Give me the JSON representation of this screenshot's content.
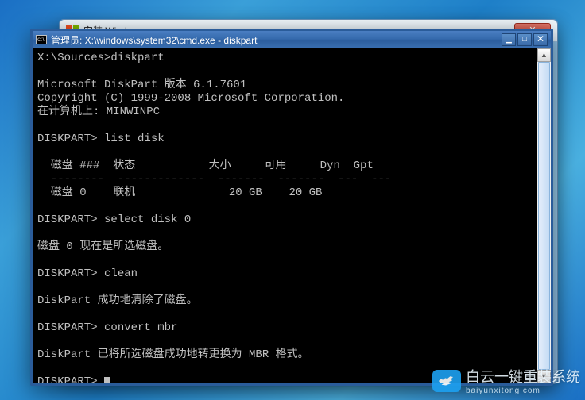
{
  "bg_window": {
    "title_fragment": "安装 Windows"
  },
  "cmd": {
    "icon_glyph": "c:\\",
    "title": "管理员: X:\\windows\\system32\\cmd.exe - diskpart",
    "minimize_glyph": "▁",
    "maximize_glyph": "□",
    "close_glyph": "✕"
  },
  "bg_close_glyph": "✕",
  "scrollbar": {
    "up_glyph": "▲",
    "down_glyph": "▼"
  },
  "term": {
    "l01": "X:\\Sources>diskpart",
    "l02": "",
    "l03": "Microsoft DiskPart 版本 6.1.7601",
    "l04": "Copyright (C) 1999-2008 Microsoft Corporation.",
    "l05": "在计算机上: MINWINPC",
    "l06": "",
    "l07": "DISKPART> list disk",
    "l08": "",
    "l09": "  磁盘 ###  状态           大小     可用     Dyn  Gpt",
    "l10": "  --------  -------------  -------  -------  ---  ---",
    "l11": "  磁盘 0    联机              20 GB    20 GB",
    "l12": "",
    "l13": "DISKPART> select disk 0",
    "l14": "",
    "l15": "磁盘 0 现在是所选磁盘。",
    "l16": "",
    "l17": "DISKPART> clean",
    "l18": "",
    "l19": "DiskPart 成功地清除了磁盘。",
    "l20": "",
    "l21": "DISKPART> convert mbr",
    "l22": "",
    "l23": "DiskPart 已将所选磁盘成功地转更换为 MBR 格式。",
    "l24": "",
    "l25": "DISKPART> "
  },
  "watermark": {
    "text": "白云一键重装系统",
    "sub": "baiyunxitong.com"
  }
}
